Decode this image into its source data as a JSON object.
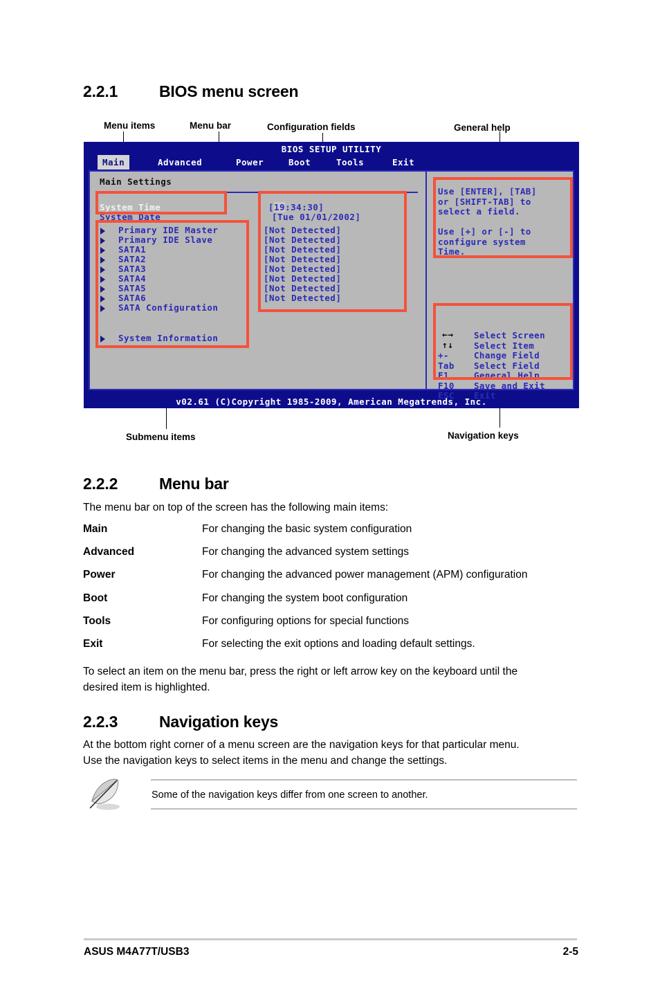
{
  "sections": {
    "s221": {
      "num": "2.2.1",
      "title": "BIOS menu screen"
    },
    "s222": {
      "num": "2.2.2",
      "title": "Menu bar"
    },
    "s223": {
      "num": "2.2.3",
      "title": "Navigation keys"
    }
  },
  "callouts": {
    "menu_items": "Menu items",
    "menu_bar": "Menu bar",
    "configuration_fields": "Configuration fields",
    "general_help": "General help",
    "submenu_items": "Submenu items",
    "navigation_keys": "Navigation keys"
  },
  "bios": {
    "title": "BIOS SETUP UTILITY",
    "menubar": [
      {
        "label": "Main",
        "active": true
      },
      {
        "label": "Advanced",
        "active": false
      },
      {
        "label": "Power",
        "active": false
      },
      {
        "label": "Boot",
        "active": false
      },
      {
        "label": "Tools",
        "active": false
      },
      {
        "label": "Exit",
        "active": false
      }
    ],
    "panel_heading": "Main Settings",
    "items": [
      {
        "label": "System Time",
        "value": "[19:34:30]",
        "value_highlight": "19",
        "submenu": false,
        "selected": true
      },
      {
        "label": "System Date",
        "value": "[Tue 01/01/2002]",
        "submenu": false,
        "selected": false
      },
      {
        "label": "Primary IDE Master",
        "value": "[Not Detected]",
        "submenu": true,
        "selected": false
      },
      {
        "label": "Primary IDE Slave",
        "value": "[Not Detected]",
        "submenu": true,
        "selected": false
      },
      {
        "label": "SATA1",
        "value": "[Not Detected]",
        "submenu": true,
        "selected": false
      },
      {
        "label": "SATA2",
        "value": "[Not Detected]",
        "submenu": true,
        "selected": false
      },
      {
        "label": "SATA3",
        "value": "[Not Detected]",
        "submenu": true,
        "selected": false
      },
      {
        "label": "SATA4",
        "value": "[Not Detected]",
        "submenu": true,
        "selected": false
      },
      {
        "label": "SATA5",
        "value": "[Not Detected]",
        "submenu": true,
        "selected": false
      },
      {
        "label": "SATA6",
        "value": "[Not Detected]",
        "submenu": true,
        "selected": false
      },
      {
        "label": "SATA Configuration",
        "value": "",
        "submenu": true,
        "selected": false
      },
      {
        "label": "System Information",
        "value": "",
        "submenu": true,
        "selected": false
      }
    ],
    "help_text": "Use [ENTER], [TAB]\nor [SHIFT-TAB] to\nselect a field.\n\nUse [+] or [-] to\nconfigure system\nTime.",
    "nav_keys": [
      {
        "key": "←→",
        "action": "Select Screen",
        "glyph": true
      },
      {
        "key": "↑↓",
        "action": "Select Item",
        "glyph": true
      },
      {
        "key": "+-",
        "action": "Change Field",
        "glyph": false
      },
      {
        "key": "Tab",
        "action": "Select Field",
        "glyph": false
      },
      {
        "key": "F1",
        "action": "General Help",
        "glyph": false
      },
      {
        "key": "F10",
        "action": "Save and Exit",
        "glyph": false
      },
      {
        "key": "ESC",
        "action": "Exit",
        "glyph": false
      }
    ],
    "copyright": "v02.61 (C)Copyright 1985-2009, American Megatrends, Inc."
  },
  "menu_bar_section": {
    "intro": "The menu bar on top of the screen has the following main items:",
    "entries": [
      {
        "term": "Main",
        "desc": "For changing the basic system configuration"
      },
      {
        "term": "Advanced",
        "desc": "For changing the advanced system settings"
      },
      {
        "term": "Power",
        "desc": "For changing the advanced power management (APM) configuration"
      },
      {
        "term": "Boot",
        "desc": "For changing the system boot configuration"
      },
      {
        "term": "Tools",
        "desc": "For configuring options for special functions"
      },
      {
        "term": "Exit",
        "desc": "For selecting the exit options and loading default settings."
      }
    ],
    "outro_line1": "To select an item on the menu bar, press the right or left arrow key on the keyboard until the",
    "outro_line2": "desired item is highlighted."
  },
  "navigation_keys_section": {
    "para_line1": "At the bottom right corner of a menu screen are the navigation keys for that particular menu.",
    "para_line2": "Use the navigation keys to select items in the menu and change the settings.",
    "note": "Some of the navigation keys differ from one screen to another."
  },
  "footer": {
    "left": "ASUS M4A77T/USB3",
    "right": "2-5"
  },
  "colors": {
    "bios_blue": "#0d0d8c",
    "bios_panel": "#b8b8b8",
    "bios_text": "#2b2bb5",
    "annotation_red": "#f4523b"
  }
}
